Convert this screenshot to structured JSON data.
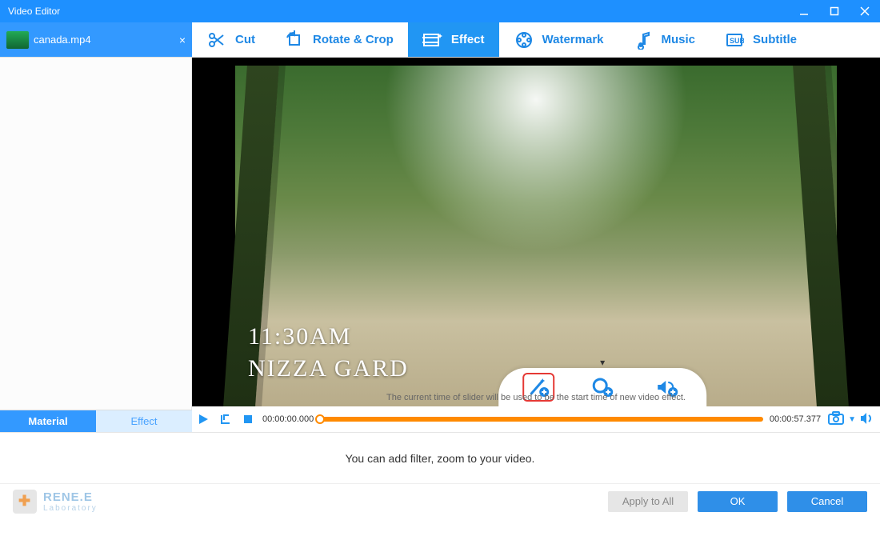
{
  "window": {
    "title": "Video Editor"
  },
  "file_tab": {
    "name": "canada.mp4"
  },
  "tabs": [
    {
      "id": "cut",
      "label": "Cut"
    },
    {
      "id": "rotate",
      "label": "Rotate & Crop"
    },
    {
      "id": "effect",
      "label": "Effect"
    },
    {
      "id": "watermark",
      "label": "Watermark"
    },
    {
      "id": "music",
      "label": "Music"
    },
    {
      "id": "subtitle",
      "label": "Subtitle"
    }
  ],
  "active_tab": "effect",
  "subtabs": {
    "material": "Material",
    "effect": "Effect",
    "active": "material"
  },
  "preview_overlay": {
    "time": "11:30AM",
    "place": "NIZZA GARD"
  },
  "effect_toolbar": {
    "hint": "The current time of slider will be used to be the start time of new video effect.",
    "buttons": [
      "filter-icon",
      "zoom-icon",
      "volume-icon"
    ]
  },
  "timeline": {
    "start": "00:00:00.000",
    "end": "00:00:57.377"
  },
  "bottom_hint": "You can add filter, zoom to your video.",
  "footer": {
    "brand_top": "RENE.E",
    "brand_sub": "Laboratory",
    "apply_all": "Apply to All",
    "ok": "OK",
    "cancel": "Cancel"
  },
  "colors": {
    "accent": "#1e90ff",
    "orange": "#ff8a00",
    "highlight": "#e53935"
  }
}
